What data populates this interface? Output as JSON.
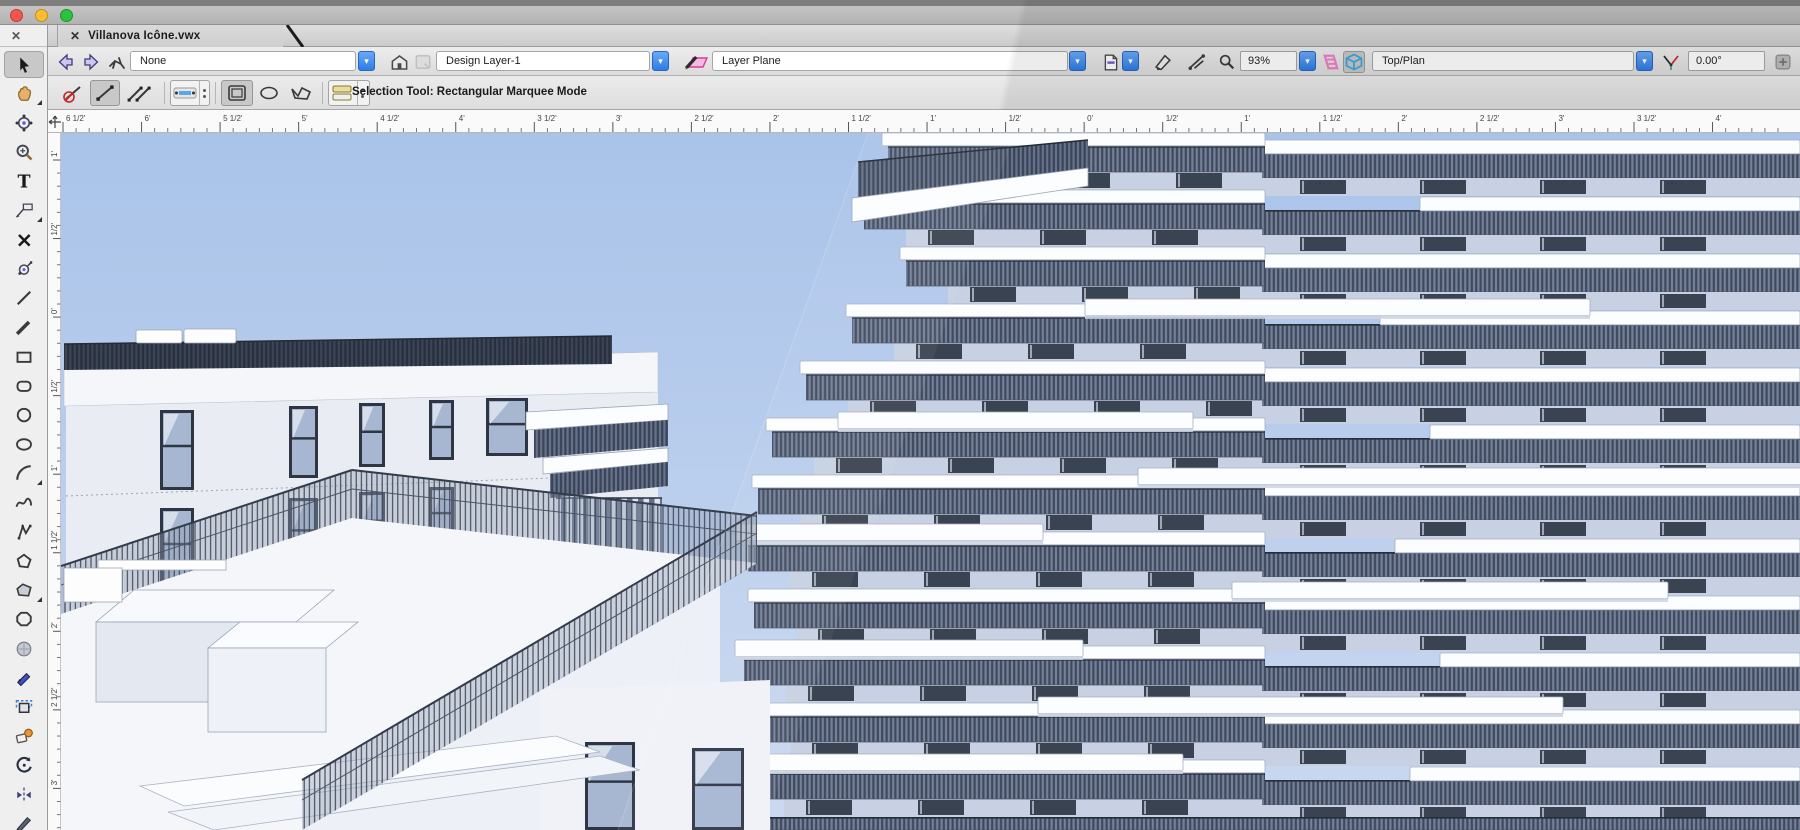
{
  "window": {
    "tab_title": "Villanova Icône.vwx",
    "close_glyph": "✕"
  },
  "toolbar": {
    "none_value": "None",
    "design_layer_value": "Design Layer-1",
    "plane_value": "Layer Plane",
    "zoom_value": "93%",
    "view_value": "Top/Plan",
    "rotation_value": "0.00°",
    "chevron_glyph": "▾"
  },
  "modebar": {
    "status_text": "Selection Tool: Rectangular Marquee Mode"
  },
  "rulers": {
    "horizontal_labels": [
      "6 1/2'",
      "6'",
      "5 1/2'",
      "5'",
      "4 1/2'",
      "4'",
      "3 1/2'",
      "3'",
      "2 1/2'",
      "2'",
      "1 1/2'",
      "1'",
      "1/2'",
      "0'",
      "1/2'",
      "1'",
      "1 1/2'",
      "2'",
      "2 1/2'",
      "3'",
      "3 1/2'",
      "4'"
    ],
    "vertical_labels": [
      "1'",
      "1/2'",
      "0'",
      "1/2'",
      "1'",
      "1 1/2'",
      "2'",
      "2 1/2'",
      "3'"
    ]
  },
  "palette": {
    "tools": [
      {
        "name": "selection-tool",
        "selected": true
      },
      {
        "name": "pan-tool",
        "flick": true
      },
      {
        "name": "flyover-tool"
      },
      {
        "name": "zoom-tool"
      },
      {
        "name": "text-tool"
      },
      {
        "name": "dimension-tool",
        "flick": true
      },
      {
        "name": "delete-tool"
      },
      {
        "name": "move-3d-tool"
      },
      {
        "name": "line-tool"
      },
      {
        "name": "double-line-tool"
      },
      {
        "name": "rectangle-tool"
      },
      {
        "name": "rounded-rectangle-tool"
      },
      {
        "name": "circle-tool"
      },
      {
        "name": "oval-tool"
      },
      {
        "name": "arc-tool",
        "flick": true
      },
      {
        "name": "freehand-tool"
      },
      {
        "name": "polyline-tool"
      },
      {
        "name": "polygon-tool"
      },
      {
        "name": "double-polygon-tool",
        "flick": true
      },
      {
        "name": "regular-polygon-tool"
      },
      {
        "name": "sphere-tool"
      },
      {
        "name": "callout-tool"
      },
      {
        "name": "clip-cube-tool"
      },
      {
        "name": "eyedropper-tool"
      },
      {
        "name": "rotate-tool"
      },
      {
        "name": "mirror-tool"
      },
      {
        "name": "reshape-tool"
      }
    ]
  },
  "colors": {
    "accent_blue": "#2e7ce6",
    "selection_pink": "#f08fd2",
    "sky_top": "#a9c3e9",
    "sky_bottom": "#cbd9f1",
    "model_dark_band": "#3d4657",
    "model_wall": "#c7d1e3",
    "traffic_red": "#f8544e",
    "traffic_yellow": "#fdbd2e",
    "traffic_green": "#2ac23f"
  }
}
